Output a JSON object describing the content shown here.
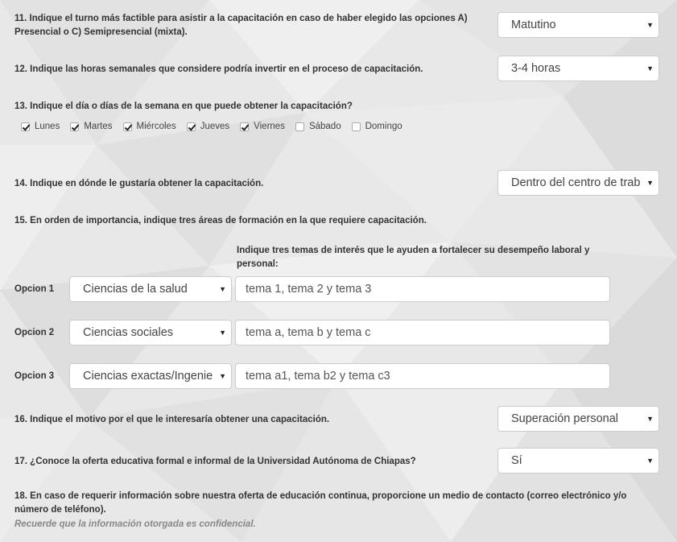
{
  "q11": {
    "label": "11. Indique el turno más factible para asistir a la capacitación en caso de haber elegido las opciones A) Presencial o C) Semipresencial (mixta).",
    "value": "Matutino"
  },
  "q12": {
    "label": "12. Indique las horas semanales que considere podría invertir en el proceso de capacitación.",
    "value": "3-4 horas"
  },
  "q13": {
    "label": "13. Indique el día o días de la semana en que puede obtener la capacitación?",
    "days": [
      {
        "label": "Lunes",
        "checked": true
      },
      {
        "label": "Martes",
        "checked": true
      },
      {
        "label": "Miércoles",
        "checked": true
      },
      {
        "label": "Jueves",
        "checked": true
      },
      {
        "label": "Viernes",
        "checked": true
      },
      {
        "label": "Sábado",
        "checked": false
      },
      {
        "label": "Domingo",
        "checked": false
      }
    ]
  },
  "q14": {
    "label": "14. Indique en dónde le gustaría obtener la capacitación.",
    "value": "Dentro del centro de trab"
  },
  "q15": {
    "label": "15. En orden de importancia, indique tres áreas de formación en la que requiere capacitación.",
    "topics_label": "Indique tres temas de interés que le ayuden a fortalecer su desempeño laboral y personal:",
    "options": [
      {
        "label": "Opcion 1",
        "area": "Ciencias de la salud",
        "topics": "tema 1, tema 2 y tema 3"
      },
      {
        "label": "Opcion 2",
        "area": "Ciencias sociales",
        "topics": "tema a, tema b y tema c"
      },
      {
        "label": "Opcion 3",
        "area": "Ciencias exactas/Ingenie",
        "topics": "tema a1, tema b2 y tema c3"
      }
    ]
  },
  "q16": {
    "label": "16. Indique el motivo por el que le interesaría obtener una capacitación.",
    "value": "Superación personal"
  },
  "q17": {
    "label": "17. ¿Conoce la oferta educativa formal e informal de la Universidad Autónoma de Chiapas?",
    "value": "Sí"
  },
  "q18": {
    "label": "18. En caso de requerir información sobre nuestra oferta de educación continua, proporcione un medio de contacto (correo electrónico y/o número de teléfono).",
    "note": "Recuerde que la información otorgada es confidencial."
  },
  "icons": {
    "caret": "▼"
  },
  "colors": {
    "background": "#e9e9e9",
    "field_border": "#cccccc"
  }
}
